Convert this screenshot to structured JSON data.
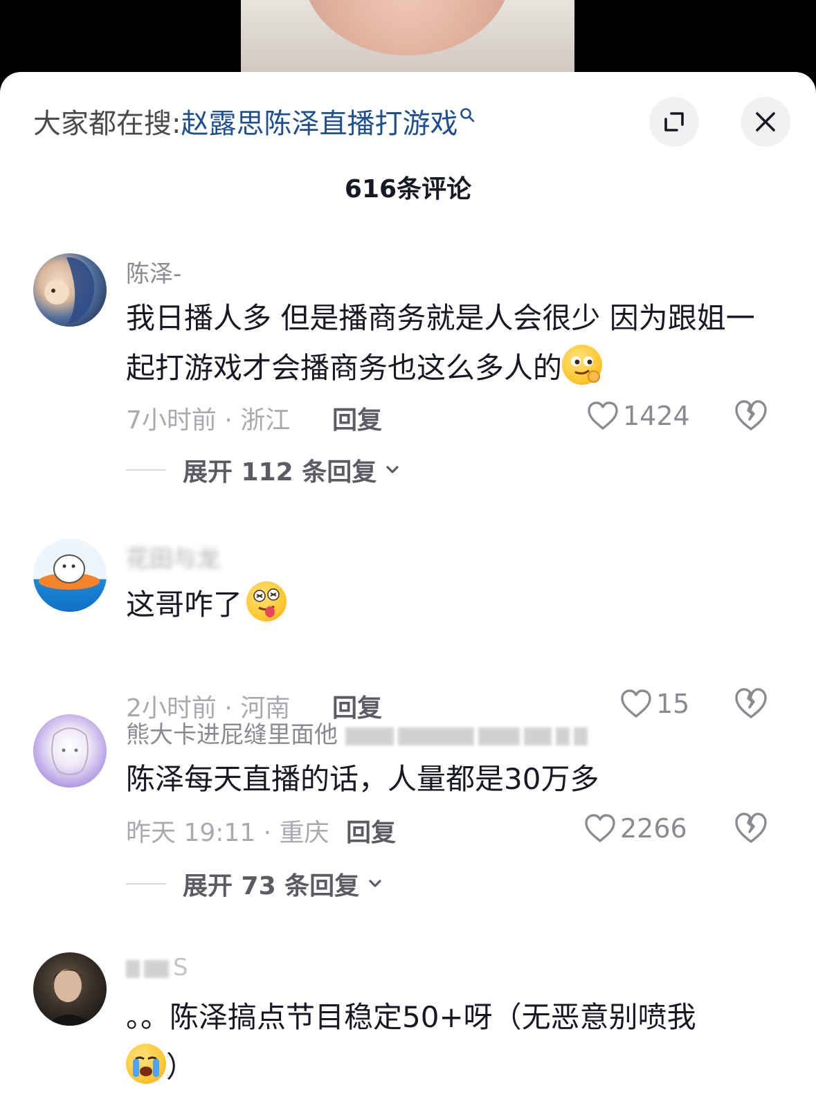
{
  "search": {
    "prefix": "大家都在搜:",
    "query": "赵露思陈泽直播打游戏",
    "colors": {
      "link": "#1f4f8f"
    }
  },
  "header": {
    "comment_count_title": "616条评论"
  },
  "comments": [
    {
      "username": "陈泽-",
      "text": "我日播人多 但是播商务就是人会很少 因为跟姐一起打游戏才会播商务也这么多人的",
      "emoji": "thinking-smirk-emoji",
      "meta": "7小时前 · 浙江",
      "reply_label": "回复",
      "likes": "1424",
      "expand_label": "展开 112 条回复"
    },
    {
      "username": "花田与龙",
      "text": "这哥咋了",
      "emoji": "crazy-face-emoji",
      "meta": "2小时前 · 河南",
      "reply_label": "回复",
      "likes": "15"
    },
    {
      "username": "熊大卡进屁缝里面他",
      "text": "陈泽每天直播的话，人量都是30万多",
      "meta": "昨天 19:11 · 重庆",
      "reply_label": "回复",
      "likes": "2266",
      "expand_label": "展开 73 条回复"
    },
    {
      "username": "S",
      "text_line1": "。。陈泽搞点节目稳定50+呀（无恶意别喷我",
      "text_line2": "）",
      "emoji": "crying-face-emoji"
    }
  ]
}
